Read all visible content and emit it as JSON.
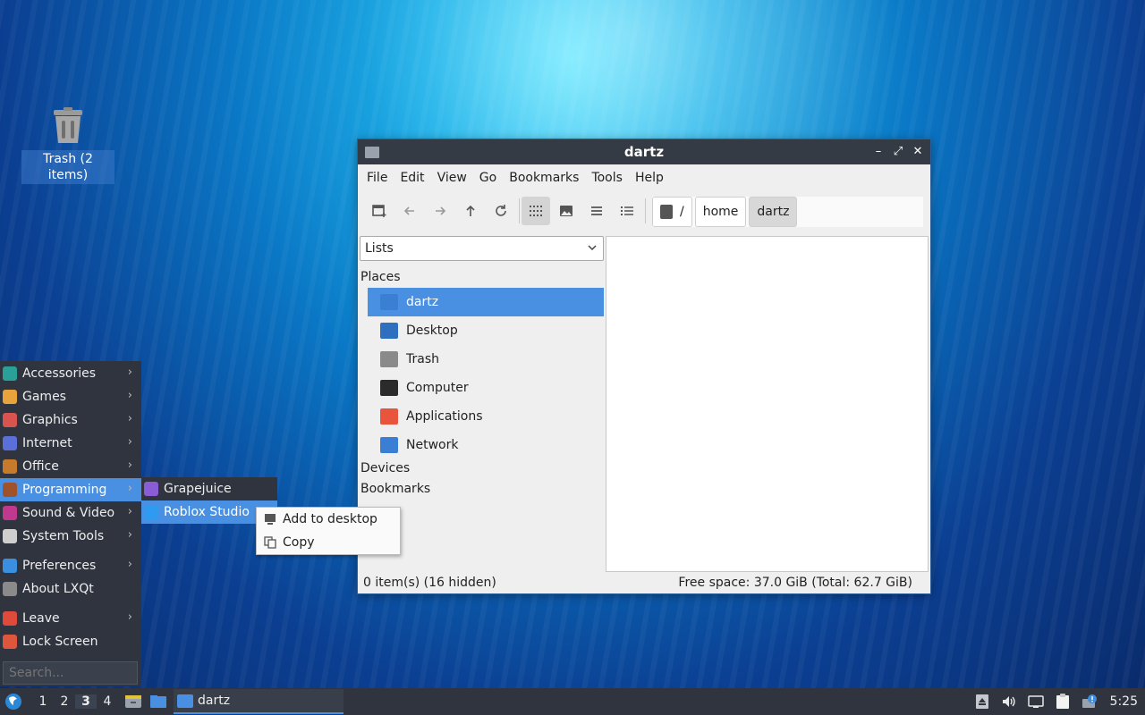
{
  "desktop": {
    "trash_label": "Trash (2 items)"
  },
  "window": {
    "title": "dartz",
    "controls": {
      "minimize": "–",
      "maximize": "⤢",
      "close": "✕"
    },
    "menubar": [
      "File",
      "Edit",
      "View",
      "Go",
      "Bookmarks",
      "Tools",
      "Help"
    ],
    "path": {
      "root": "/",
      "segments": [
        "home",
        "dartz"
      ]
    },
    "side_select": "Lists",
    "sections": {
      "places": "Places",
      "devices": "Devices",
      "bookmarks": "Bookmarks"
    },
    "places": [
      {
        "label": "dartz",
        "icon": "home-folder-icon",
        "color": "#3b7fd4"
      },
      {
        "label": "Desktop",
        "icon": "desktop-icon",
        "color": "#2f6fc0"
      },
      {
        "label": "Trash",
        "icon": "trash-icon",
        "color": "#8a8a8a"
      },
      {
        "label": "Computer",
        "icon": "computer-icon",
        "color": "#2b2b2b"
      },
      {
        "label": "Applications",
        "icon": "applications-icon",
        "color": "#e8553c"
      },
      {
        "label": "Network",
        "icon": "network-icon",
        "color": "#3b7fd4"
      }
    ],
    "status_left": "0 item(s) (16 hidden)",
    "status_right": "Free space: 37.0 GiB (Total: 62.7 GiB)"
  },
  "app_menu": {
    "items": [
      {
        "label": "Accessories",
        "icon": "accessories-icon",
        "color": "#2aa198"
      },
      {
        "label": "Games",
        "icon": "games-icon",
        "color": "#e8a33c"
      },
      {
        "label": "Graphics",
        "icon": "graphics-icon",
        "color": "#d9534f"
      },
      {
        "label": "Internet",
        "icon": "internet-icon",
        "color": "#5b6fd8"
      },
      {
        "label": "Office",
        "icon": "office-icon",
        "color": "#c77a2b"
      },
      {
        "label": "Programming",
        "icon": "programming-icon",
        "color": "#a0522d"
      },
      {
        "label": "Sound & Video",
        "icon": "sound-video-icon",
        "color": "#c0398f"
      },
      {
        "label": "System Tools",
        "icon": "system-tools-icon",
        "color": "#cfcfcf"
      }
    ],
    "items2": [
      {
        "label": "Preferences",
        "icon": "preferences-icon",
        "color": "#3b8fe0"
      },
      {
        "label": "About LXQt",
        "icon": "info-icon",
        "color": "#8a8a8a"
      }
    ],
    "items3": [
      {
        "label": "Leave",
        "icon": "power-icon",
        "color": "#e04a3c"
      },
      {
        "label": "Lock Screen",
        "icon": "lock-icon",
        "color": "#e0563c"
      }
    ],
    "search_placeholder": "Search..."
  },
  "submenu": [
    {
      "label": "Grapejuice",
      "icon": "grapejuice-icon",
      "color": "#8a5cd6"
    },
    {
      "label": "Roblox Studio",
      "icon": "roblox-studio-icon",
      "color": "#2e9bf0"
    }
  ],
  "context_menu": [
    {
      "label": "Add to desktop",
      "icon": "add-to-desktop-icon"
    },
    {
      "label": "Copy",
      "icon": "copy-icon"
    }
  ],
  "taskbar": {
    "desktops": [
      "1",
      "2",
      "3",
      "4"
    ],
    "active_desktop": "3",
    "task_label": "dartz",
    "clock": "5:25"
  }
}
